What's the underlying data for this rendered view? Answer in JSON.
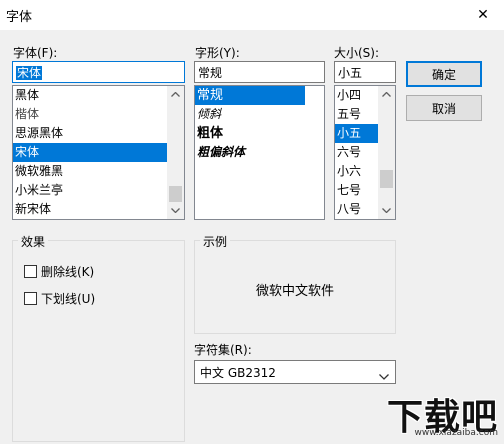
{
  "window": {
    "title": "字体",
    "close_glyph": "✕"
  },
  "font": {
    "label": "字体(F):",
    "value": "宋体",
    "items": [
      "黑体",
      "楷体",
      "思源黑体",
      "宋体",
      "微软雅黑",
      "小米兰亭",
      "新宋体"
    ],
    "selected_index": 3
  },
  "style": {
    "label": "字形(Y):",
    "value": "常规",
    "items": [
      "常规",
      "倾斜",
      "粗体",
      "粗偏斜体"
    ],
    "selected_index": 0
  },
  "size": {
    "label": "大小(S):",
    "value": "小五",
    "items": [
      "小四",
      "五号",
      "小五",
      "六号",
      "小六",
      "七号",
      "八号"
    ],
    "selected_index": 2
  },
  "buttons": {
    "ok": "确定",
    "cancel": "取消"
  },
  "effects": {
    "label": "效果",
    "strikeout": {
      "label": "删除线(K)",
      "checked": false
    },
    "underline": {
      "label": "下划线(U)",
      "checked": false
    }
  },
  "sample": {
    "label": "示例",
    "text": "微软中文软件"
  },
  "script": {
    "label": "字符集(R):",
    "value": "中文 GB2312"
  },
  "watermark": {
    "logo": "下载吧",
    "url": "www.xiazaiba.com"
  }
}
